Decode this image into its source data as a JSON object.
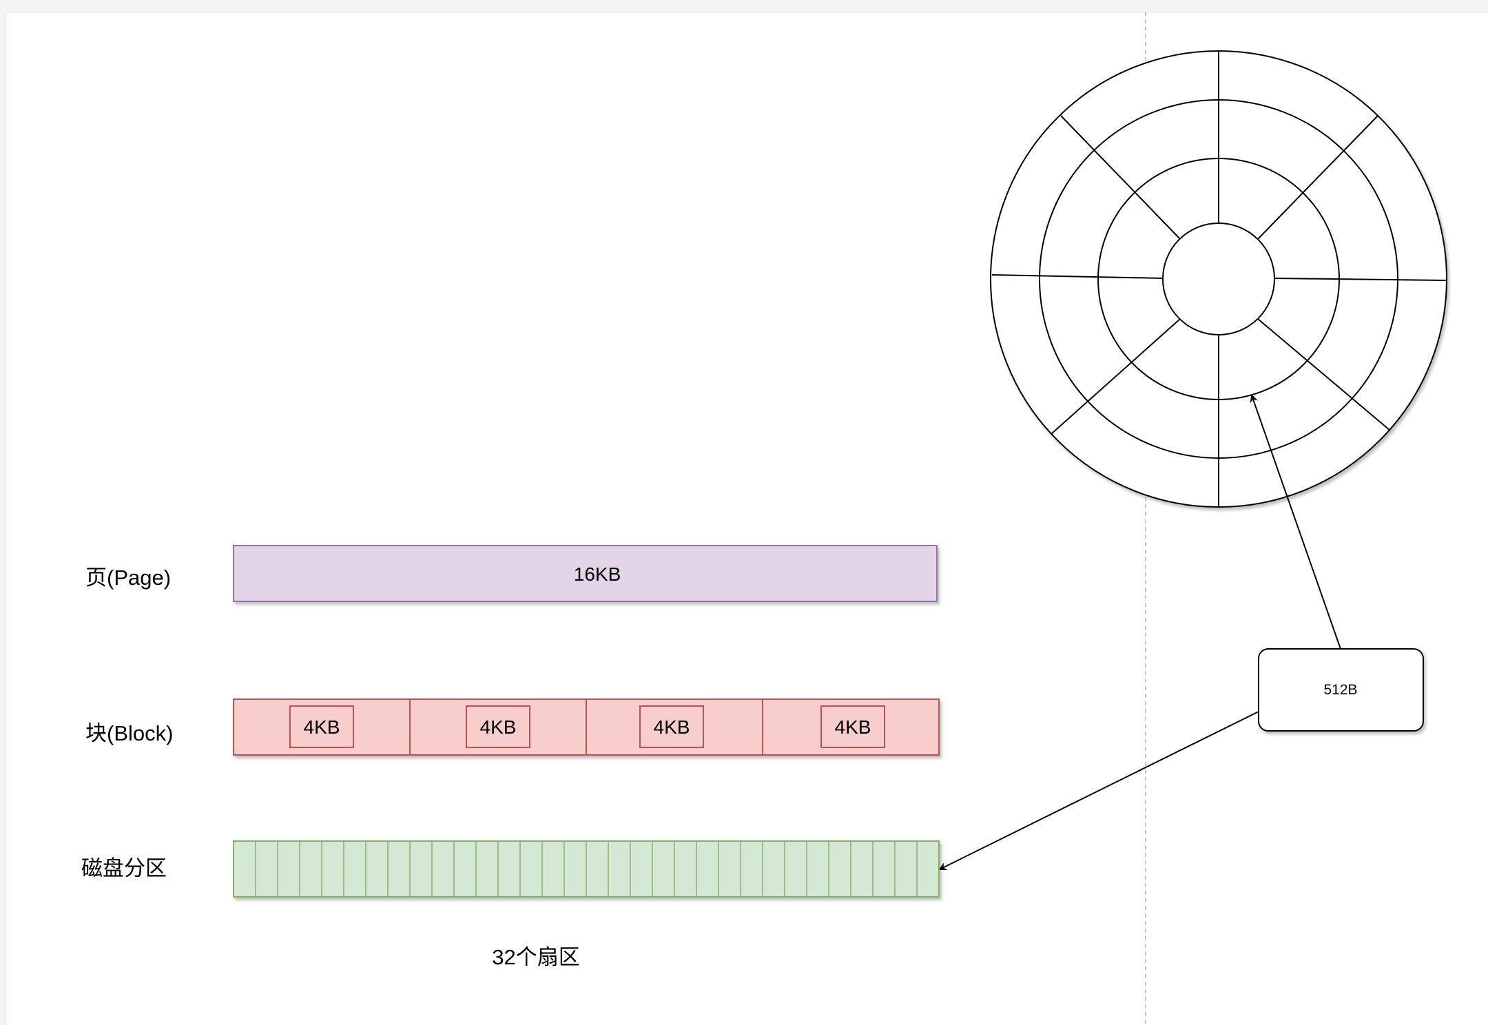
{
  "rows": {
    "page": {
      "label": "页(Page)",
      "size": "16KB"
    },
    "block": {
      "label": "块(Block)",
      "sizes": [
        "4KB",
        "4KB",
        "4KB",
        "4KB"
      ]
    },
    "disk": {
      "label": "磁盘分区",
      "sector_count": 32,
      "caption": "32个扇区"
    }
  },
  "callout": {
    "text": "512B"
  },
  "colors": {
    "page_fill": "#e1d5e7",
    "page_stroke": "#9673a6",
    "block_fill": "#f8cecc",
    "block_stroke": "#b85450",
    "disk_fill": "#d5e8d4",
    "disk_stroke": "#82b366"
  }
}
